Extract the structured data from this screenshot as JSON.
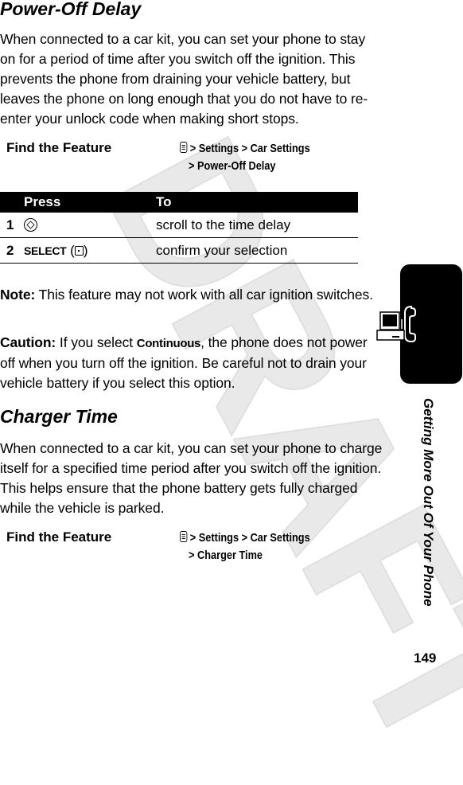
{
  "watermark": "DRAFT",
  "section1": {
    "title": "Power-Off Delay",
    "intro": "When connected to a car kit, you can set your phone to stay on for a period of time after you switch off the ignition. This prevents the phone from draining your vehicle battery, but leaves the phone on long enough that you do not have to re-enter your unlock code when making short stops.",
    "find_feature": {
      "label": "Find the Feature",
      "icon": "menu-key-icon",
      "path_line1": "> Settings > Car Settings",
      "path_line2": "> Power-Off Delay"
    },
    "table": {
      "headers": [
        "Press",
        "To"
      ],
      "rows": [
        {
          "step": "1",
          "press_icon": "nav-key-icon",
          "press_text": "",
          "to": "scroll to the time delay"
        },
        {
          "step": "2",
          "press_text": "SELECT",
          "press_icon": "select-key-icon",
          "to": "confirm your selection"
        }
      ]
    },
    "note_label": "Note:",
    "note_text": " This feature may not work with all car ignition switches.",
    "caution_label": "Caution:",
    "caution_pre": " If you select ",
    "caution_option": "Continuous",
    "caution_post": ", the phone does not power off when you turn off the ignition. Be careful not to drain your vehicle battery if you select this option."
  },
  "section2": {
    "title": "Charger Time",
    "intro": "When connected to a car kit, you can set your phone to charge itself for a specified time period after you switch off the ignition. This helps ensure that the phone battery gets fully charged while the vehicle is parked.",
    "find_feature": {
      "label": "Find the Feature",
      "icon": "menu-key-icon",
      "path_line1": "> Settings > Car Settings",
      "path_line2": "> Charger Time"
    }
  },
  "sidebar": {
    "chapter_icon": "computer-phone-icon",
    "chapter_title": "Getting More Out Of Your Phone"
  },
  "page_number": "149"
}
